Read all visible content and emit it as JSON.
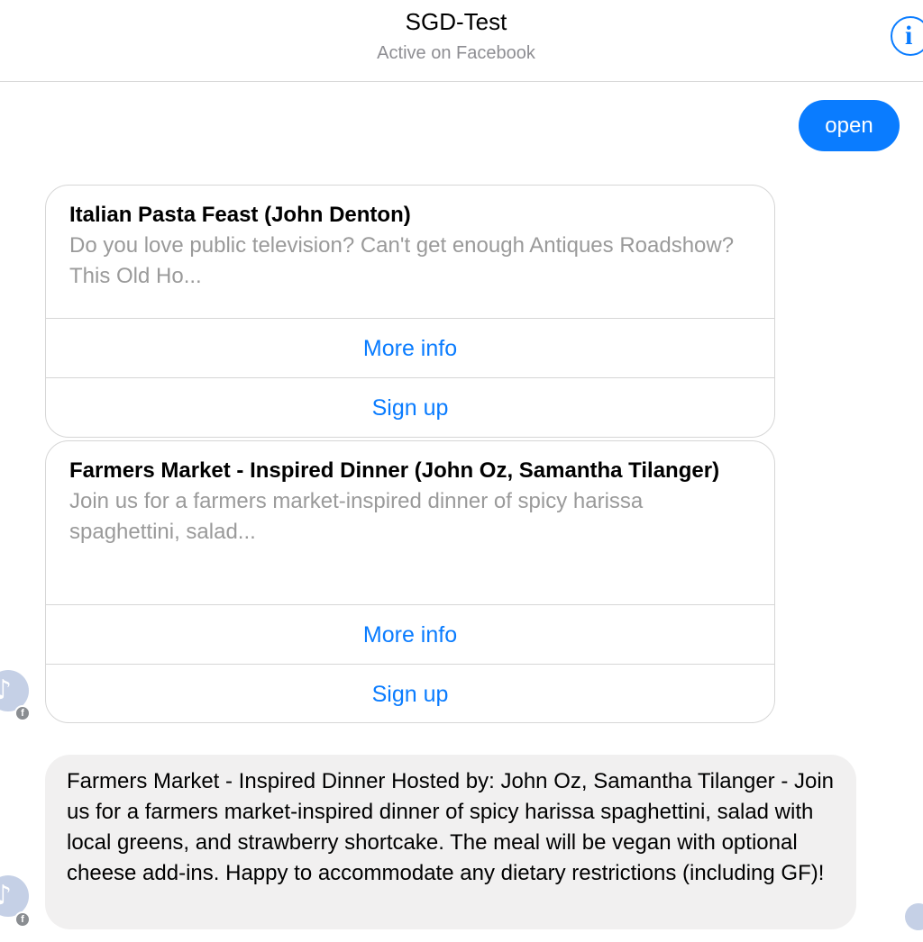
{
  "header": {
    "title": "SGD-Test",
    "subtitle": "Active on Facebook",
    "info_icon": "i"
  },
  "outgoing_message": {
    "text": "open"
  },
  "cards": [
    {
      "title": "Italian Pasta Feast (John Denton)",
      "description": "Do you love public television? Can't get enough Antiques Roadshow? This Old Ho...",
      "buttons": [
        "More info",
        "Sign up"
      ]
    },
    {
      "title": "Farmers Market - Inspired Dinner (John Oz, Samantha Tilanger)",
      "description": "Join us for a farmers market-inspired dinner of spicy harissa spaghettini, salad...",
      "buttons": [
        "More info",
        "Sign up"
      ]
    }
  ],
  "incoming_message": {
    "text": "Farmers Market - Inspired Dinner Hosted by: John Oz, Samantha Tilanger - Join us for a farmers market-inspired dinner of spicy harissa spaghettini, salad with local greens, and strawberry shortcake. The meal will be vegan with optional cheese add-ins. Happy to accommodate any dietary restrictions (including GF)!"
  },
  "icons": {
    "info": "info-icon",
    "avatar": "avatar-icon",
    "facebook_badge": "facebook-icon",
    "facebook_badge_glyph": "f"
  },
  "colors": {
    "accent": "#0a7cff",
    "incoming_bubble": "#f1f0f0",
    "muted_text": "#9a9a9a"
  }
}
